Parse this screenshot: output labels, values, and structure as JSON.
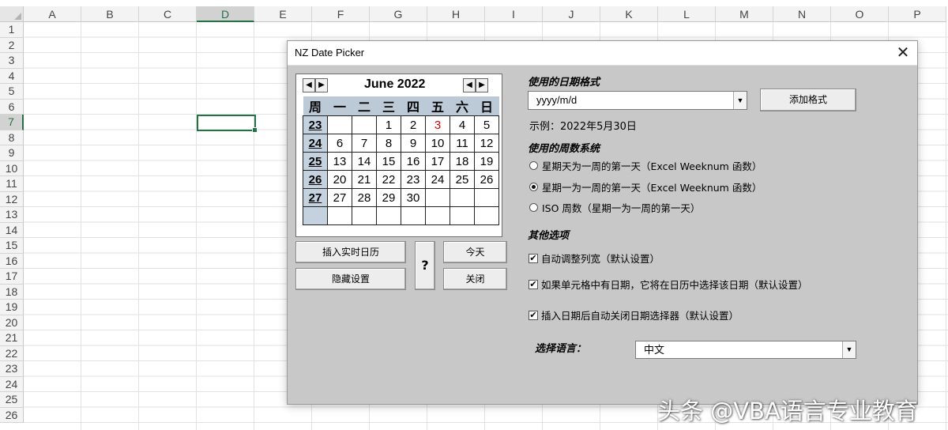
{
  "sheet": {
    "columns": [
      "A",
      "B",
      "C",
      "D",
      "E",
      "F",
      "G",
      "H",
      "I",
      "J",
      "K",
      "L",
      "M",
      "N",
      "O",
      "P"
    ],
    "rows": [
      "1",
      "2",
      "3",
      "4",
      "5",
      "6",
      "7",
      "8",
      "9",
      "10",
      "11",
      "12",
      "13",
      "14",
      "15",
      "16",
      "17",
      "18",
      "19",
      "20",
      "21",
      "22",
      "23",
      "24",
      "25",
      "26"
    ],
    "selected_column": "D",
    "selected_row": "7"
  },
  "dialog": {
    "title": "NZ Date Picker",
    "close_glyph": "✕",
    "calendar": {
      "month_label": "June 2022",
      "nav_prev": "◀",
      "nav_next": "▶",
      "header": [
        "周",
        "一",
        "二",
        "三",
        "四",
        "五",
        "六",
        "日"
      ],
      "weeks": [
        [
          "23",
          "",
          "",
          "1",
          "2",
          "3",
          "4",
          "5"
        ],
        [
          "24",
          "6",
          "7",
          "8",
          "9",
          "10",
          "11",
          "12"
        ],
        [
          "25",
          "13",
          "14",
          "15",
          "16",
          "17",
          "18",
          "19"
        ],
        [
          "26",
          "20",
          "21",
          "22",
          "23",
          "24",
          "25",
          "26"
        ],
        [
          "27",
          "27",
          "28",
          "29",
          "30",
          "",
          "",
          ""
        ],
        [
          "",
          "",
          "",
          "",
          "",
          "",
          "",
          ""
        ]
      ],
      "highlight_day": "3",
      "highlight_color": "#e00000"
    },
    "buttons": {
      "insert_live": "插入实时日历",
      "hide_settings": "隐藏设置",
      "help": "?",
      "today": "今天",
      "close": "关闭"
    },
    "date_format": {
      "heading": "使用的日期格式",
      "value": "yyyy/m/d",
      "add_button": "添加格式",
      "example": "示例：2022年5月30日"
    },
    "week_system": {
      "heading": "使用的周数系统",
      "options": [
        {
          "label": "星期天为一周的第一天（Excel Weeknum 函数）",
          "selected": false
        },
        {
          "label": "星期一为一周的第一天（Excel Weeknum 函数）",
          "selected": true
        },
        {
          "label": "ISO 周数（星期一为一周的第一天）",
          "selected": false
        }
      ]
    },
    "other_options": {
      "heading": "其他选项",
      "items": [
        {
          "label": "自动调整列宽（默认设置）",
          "checked": true
        },
        {
          "label": "如果单元格中有日期，它将在日历中选择该日期（默认设置）",
          "checked": true
        },
        {
          "label": "插入日期后自动关闭日期选择器（默认设置）",
          "checked": true
        }
      ]
    },
    "language": {
      "label": "选择语言：",
      "value": "中文"
    }
  },
  "watermark": "头条 @VBA语言专业教育"
}
